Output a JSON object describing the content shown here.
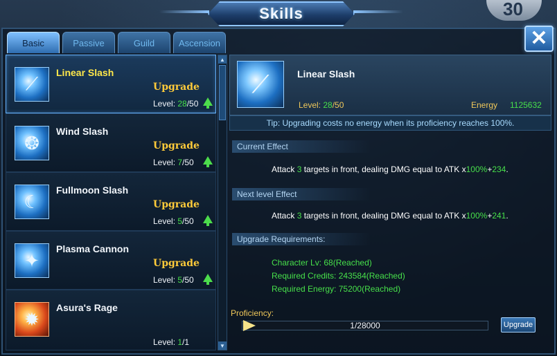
{
  "title": "Skills",
  "corner_badge": "30",
  "close_icon": "✕",
  "tabs": [
    {
      "label": "Basic",
      "active": true
    },
    {
      "label": "Passive",
      "active": false
    },
    {
      "label": "Guild",
      "active": false
    },
    {
      "label": "Ascension",
      "active": false
    }
  ],
  "skills": [
    {
      "name": "Linear Slash",
      "upgrade": "Upgrade",
      "level_prefix": "Level: ",
      "level_cur": "28",
      "level_max": "/50",
      "icon": "slash-icon",
      "selected": true
    },
    {
      "name": "Wind Slash",
      "upgrade": "Upgrade",
      "level_prefix": "Level: ",
      "level_cur": "7",
      "level_max": "/50",
      "icon": "wind-icon"
    },
    {
      "name": "Fullmoon Slash",
      "upgrade": "Upgrade",
      "level_prefix": "Level: ",
      "level_cur": "5",
      "level_max": "/50",
      "icon": "moon-icon"
    },
    {
      "name": "Plasma Cannon",
      "upgrade": "Upgrade",
      "level_prefix": "Level: ",
      "level_cur": "5",
      "level_max": "/50",
      "icon": "plasma-icon"
    },
    {
      "name": "Asura's Rage",
      "upgrade": "",
      "level_prefix": "Level: ",
      "level_cur": "1",
      "level_max": "/1",
      "icon": "rage-icon"
    }
  ],
  "detail": {
    "name": "Linear Slash",
    "level_prefix": "Level: ",
    "level_cur": "28",
    "level_max": "/50",
    "energy_label": "Energy",
    "energy_value": "1125632",
    "tip": "Tip: Upgrading costs no energy when its proficiency reaches 100%.",
    "current_effect_title": "Current Effect",
    "current_effect": {
      "a": "Attack ",
      "targets": "3",
      "b": " targets in front, dealing DMG equal to ATK x",
      "pct": "100%",
      "plus": "+",
      "flat": "234",
      "end": "."
    },
    "next_effect_title": "Next level Effect",
    "next_effect": {
      "a": "Attack ",
      "targets": "3",
      "b": " targets in front, dealing DMG equal to ATK x",
      "pct": "100%",
      "plus": "+",
      "flat": "241",
      "end": "."
    },
    "requirements_title": "Upgrade Requirements:",
    "requirements": [
      "Character Lv: 68(Reached)",
      "Required Credits: 243584(Reached)",
      "Required Energy: 75200(Reached)"
    ],
    "proficiency_label": "Proficiency:",
    "proficiency_text": "1/28000",
    "proficiency_fraction": 3.57e-05,
    "upgrade_button": "Upgrade"
  }
}
